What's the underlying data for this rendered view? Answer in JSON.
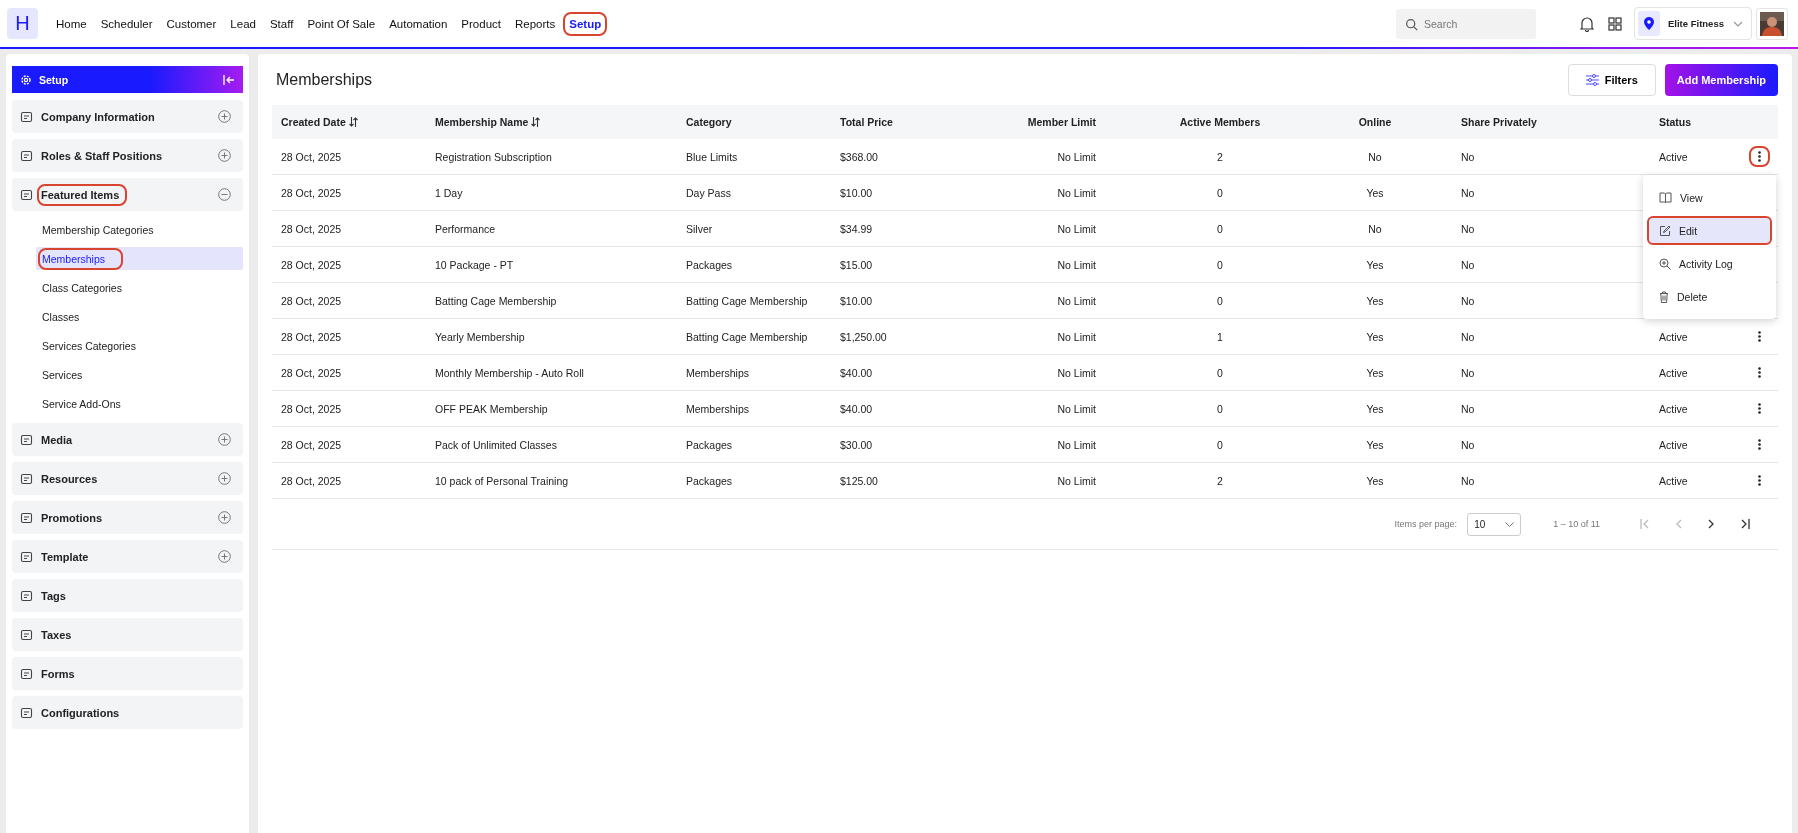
{
  "logo": "H",
  "nav": [
    {
      "label": "Home",
      "selected": false,
      "highlighted": false
    },
    {
      "label": "Scheduler",
      "selected": false,
      "highlighted": false
    },
    {
      "label": "Customer",
      "selected": false,
      "highlighted": false
    },
    {
      "label": "Lead",
      "selected": false,
      "highlighted": false
    },
    {
      "label": "Staff",
      "selected": false,
      "highlighted": false
    },
    {
      "label": "Point Of Sale",
      "selected": false,
      "highlighted": false
    },
    {
      "label": "Automation",
      "selected": false,
      "highlighted": false
    },
    {
      "label": "Product",
      "selected": false,
      "highlighted": false
    },
    {
      "label": "Reports",
      "selected": false,
      "highlighted": false
    },
    {
      "label": "Setup",
      "selected": true,
      "highlighted": true
    }
  ],
  "search": {
    "placeholder": "Search"
  },
  "location": {
    "name": "Elite Fitness"
  },
  "sidebar": {
    "title": "Setup",
    "items": [
      {
        "kind": "group",
        "label": "Company Information",
        "expanded": false,
        "highlighted": false
      },
      {
        "kind": "group",
        "label": "Roles & Staff Positions",
        "expanded": false,
        "highlighted": false
      },
      {
        "kind": "group",
        "label": "Featured Items",
        "expanded": true,
        "highlighted": true,
        "children": [
          {
            "label": "Membership Categories",
            "selected": false,
            "highlighted": false
          },
          {
            "label": "Memberships",
            "selected": true,
            "highlighted": true
          },
          {
            "label": "Class Categories",
            "selected": false,
            "highlighted": false
          },
          {
            "label": "Classes",
            "selected": false,
            "highlighted": false
          },
          {
            "label": "Services Categories",
            "selected": false,
            "highlighted": false
          },
          {
            "label": "Services",
            "selected": false,
            "highlighted": false
          },
          {
            "label": "Service Add-Ons",
            "selected": false,
            "highlighted": false
          }
        ]
      },
      {
        "kind": "group",
        "label": "Media",
        "expanded": false,
        "highlighted": false
      },
      {
        "kind": "group",
        "label": "Resources",
        "expanded": false,
        "highlighted": false
      },
      {
        "kind": "group",
        "label": "Promotions",
        "expanded": false,
        "highlighted": false
      },
      {
        "kind": "group",
        "label": "Template",
        "expanded": false,
        "highlighted": false
      },
      {
        "kind": "link",
        "label": "Tags",
        "highlighted": false
      },
      {
        "kind": "link",
        "label": "Taxes",
        "highlighted": false
      },
      {
        "kind": "link",
        "label": "Forms",
        "highlighted": false
      },
      {
        "kind": "link",
        "label": "Configurations",
        "highlighted": false
      }
    ]
  },
  "page": {
    "title": "Memberships",
    "filters_button": "Filters",
    "add_button": "Add Membership"
  },
  "table": {
    "columns": [
      {
        "label": "Created Date",
        "sortable": true
      },
      {
        "label": "Membership Name",
        "sortable": true
      },
      {
        "label": "Category",
        "sortable": false
      },
      {
        "label": "Total Price",
        "sortable": false
      },
      {
        "label": "Member Limit",
        "sortable": false
      },
      {
        "label": "Active Members",
        "sortable": false
      },
      {
        "label": "Online",
        "sortable": false
      },
      {
        "label": "Share Privately",
        "sortable": false
      },
      {
        "label": "Status",
        "sortable": false
      }
    ],
    "rows": [
      {
        "cells": [
          "28 Oct, 2025",
          "Registration Subscription",
          "Blue Limits",
          "$368.00",
          "No Limit",
          "2",
          "No",
          "No",
          "Active"
        ],
        "actions_button": {
          "highlighted": true
        }
      },
      {
        "cells": [
          "28 Oct, 2025",
          "1 Day",
          "Day Pass",
          "$10.00",
          "No Limit",
          "0",
          "Yes",
          "No"
        ]
      },
      {
        "cells": [
          "28 Oct, 2025",
          "Performance",
          "Silver",
          "$34.99",
          "No Limit",
          "0",
          "No",
          "No"
        ]
      },
      {
        "cells": [
          "28 Oct, 2025",
          "10 Package - PT",
          "Packages",
          "$15.00",
          "No Limit",
          "0",
          "Yes",
          "No"
        ]
      },
      {
        "cells": [
          "28 Oct, 2025",
          "Batting Cage Membership",
          "Batting Cage Membership",
          "$10.00",
          "No Limit",
          "0",
          "Yes",
          "No"
        ]
      },
      {
        "cells": [
          "28 Oct, 2025",
          "Yearly Membership",
          "Batting Cage Membership",
          "$1,250.00",
          "No Limit",
          "1",
          "Yes",
          "No",
          "Active"
        ],
        "actions_button": {
          "highlighted": false
        }
      },
      {
        "cells": [
          "28 Oct, 2025",
          "Monthly Membership - Auto Roll",
          "Memberships",
          "$40.00",
          "No Limit",
          "0",
          "Yes",
          "No",
          "Active"
        ],
        "actions_button": {
          "highlighted": false
        }
      },
      {
        "cells": [
          "28 Oct, 2025",
          "OFF PEAK Membership",
          "Memberships",
          "$40.00",
          "No Limit",
          "0",
          "Yes",
          "No",
          "Active"
        ],
        "actions_button": {
          "highlighted": false
        }
      },
      {
        "cells": [
          "28 Oct, 2025",
          "Pack of Unlimited Classes",
          "Packages",
          "$30.00",
          "No Limit",
          "0",
          "Yes",
          "No",
          "Active"
        ],
        "actions_button": {
          "highlighted": false
        }
      },
      {
        "cells": [
          "28 Oct, 2025",
          "10 pack of Personal Training",
          "Packages",
          "$125.00",
          "No Limit",
          "2",
          "Yes",
          "No",
          "Active"
        ],
        "actions_button": {
          "highlighted": false
        }
      }
    ]
  },
  "row_menu": [
    {
      "label": "View",
      "selected": false,
      "highlighted": false
    },
    {
      "label": "Edit",
      "selected": true,
      "highlighted": true
    },
    {
      "label": "Activity Log",
      "selected": false,
      "highlighted": false
    },
    {
      "label": "Delete",
      "selected": false,
      "highlighted": false
    }
  ],
  "pagination": {
    "items_per_page_label": "Items per page:",
    "page_size": "10",
    "range": "1 – 10 of 11"
  }
}
